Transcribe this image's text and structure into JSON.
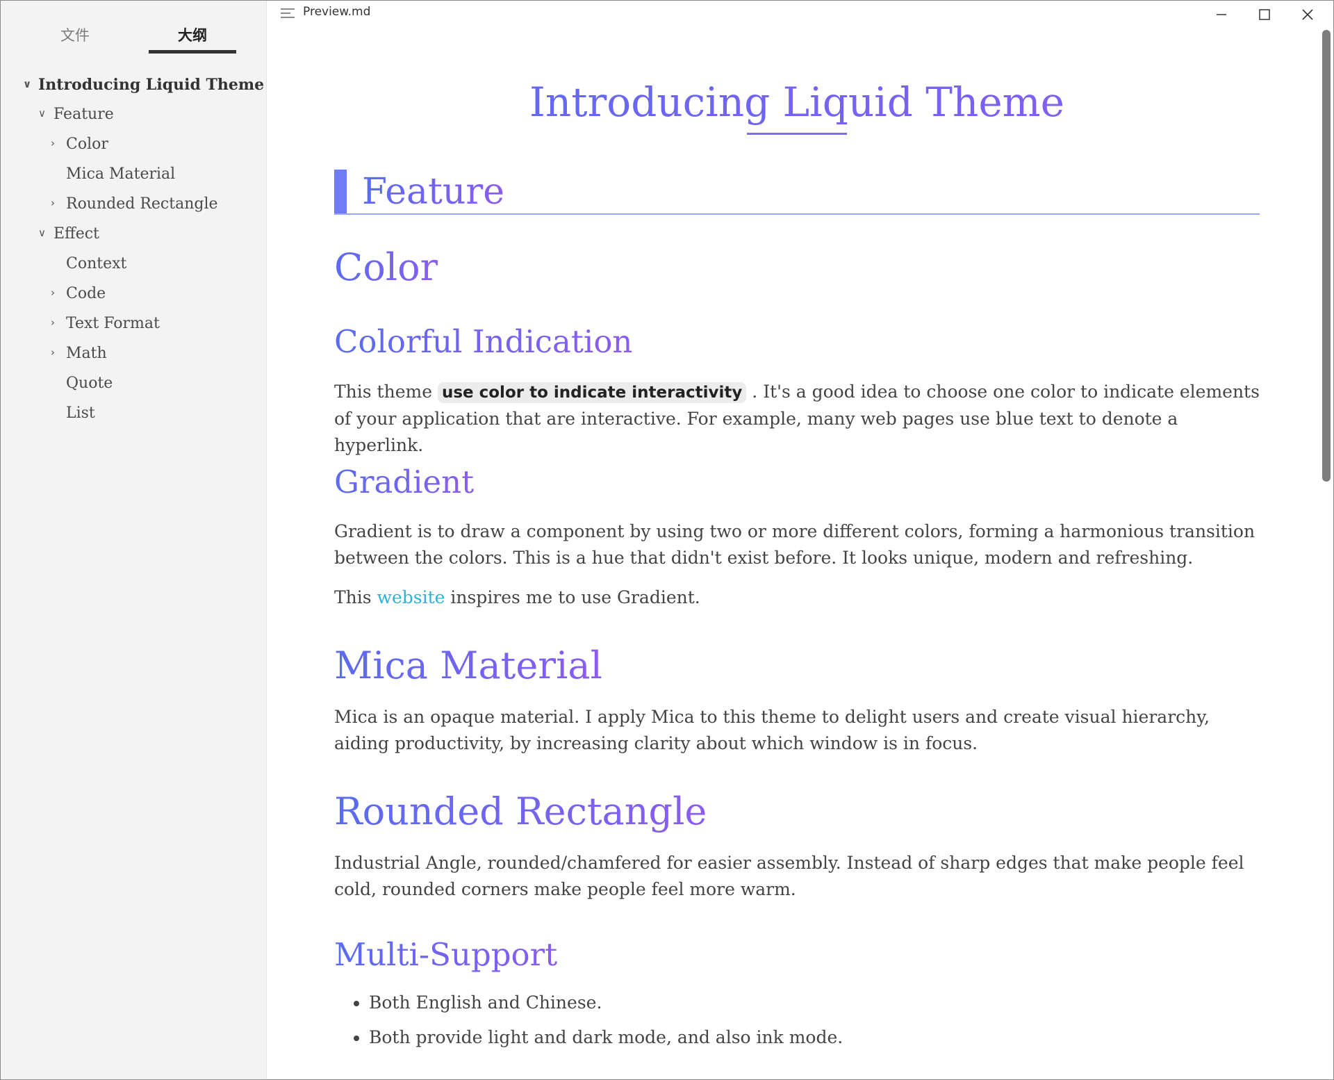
{
  "window": {
    "title": "Preview.md"
  },
  "sidebar": {
    "tabs": [
      {
        "label": "文件"
      },
      {
        "label": "大纲"
      }
    ],
    "outline": [
      {
        "label": "Introducing Liquid Theme",
        "chevron": "v"
      },
      {
        "label": "Feature",
        "chevron": "v"
      },
      {
        "label": "Color",
        "chevron": ">"
      },
      {
        "label": "Mica Material",
        "chevron": ""
      },
      {
        "label": "Rounded Rectangle",
        "chevron": ">"
      },
      {
        "label": "Effect",
        "chevron": "v"
      },
      {
        "label": "Context",
        "chevron": ""
      },
      {
        "label": "Code",
        "chevron": ">"
      },
      {
        "label": "Text Format",
        "chevron": ">"
      },
      {
        "label": "Math",
        "chevron": ">"
      },
      {
        "label": "Quote",
        "chevron": ""
      },
      {
        "label": "List",
        "chevron": ""
      }
    ]
  },
  "doc": {
    "title": "Introducing Liquid Theme",
    "h2_feature": "Feature",
    "h3_color": "Color",
    "h4_colorful": "Colorful Indication",
    "p_colorful_pre": "This theme ",
    "p_colorful_code": "use color to indicate interactivity",
    "p_colorful_post": " . It's a good idea to choose one color to indicate elements of your application that are interactive. For example, many web pages use blue text to denote a hyperlink.",
    "h4_gradient": "Gradient",
    "p_gradient": "Gradient is to draw a component by using two or more different colors, forming a harmonious transition between the colors. This is a hue that didn't exist before. It looks unique, modern and refreshing.",
    "p_website_pre": "This ",
    "p_website_link": "website",
    "p_website_post": " inspires me to use Gradient.",
    "h3_mica": "Mica Material",
    "p_mica": "Mica is an opaque material. I apply Mica to this theme to delight users and create visual hierarchy, aiding productivity, by increasing clarity about which window is in focus.",
    "h3_rounded": "Rounded Rectangle",
    "p_rounded": "Industrial Angle, rounded/chamfered for easier assembly. Instead of sharp edges that make people feel cold, rounded corners make people feel more warm.",
    "h4_multi": "Multi-Support",
    "bullets": [
      "Both English and Chinese.",
      "Both provide light and dark mode, and also ink mode."
    ]
  },
  "colors": {
    "accent_start": "#5a6cf0",
    "accent_end": "#8b5cf0",
    "link": "#2bb3d6",
    "sidebar_bg": "#f3f3f3"
  }
}
